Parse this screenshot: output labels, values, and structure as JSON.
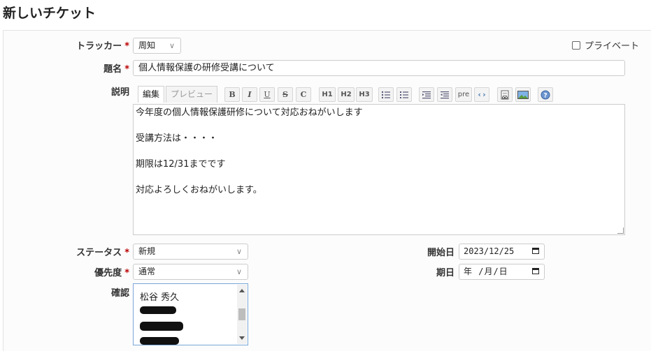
{
  "page": {
    "title": "新しいチケット"
  },
  "form": {
    "tracker": {
      "label": "トラッカー",
      "required_mark": "*",
      "value": "周知"
    },
    "private": {
      "label": "プライベート",
      "checked": false
    },
    "subject": {
      "label": "題名",
      "required_mark": "*",
      "value": "個人情報保護の研修受講について"
    },
    "description": {
      "label": "説明",
      "tabs": {
        "edit": "編集",
        "preview": "プレビュー"
      },
      "toolbar": {
        "bold": "B",
        "italic": "I",
        "underline": "U",
        "strike": "S",
        "code": "C",
        "h1": "H1",
        "h2": "H2",
        "h3": "H3",
        "pre": "pre"
      },
      "lines": [
        "今年度の個人情報保護研修について対応おねがいします",
        "",
        "受講方法は・・・・",
        "",
        "期限は12/31までです",
        "",
        "対応よろしくおねがいします。"
      ]
    },
    "status": {
      "label": "ステータス",
      "required_mark": "*",
      "value": "新規"
    },
    "priority": {
      "label": "優先度",
      "required_mark": "*",
      "value": "通常"
    },
    "start_date": {
      "label": "開始日",
      "value": "2023/12/25"
    },
    "due_date": {
      "label": "期日",
      "value": "年 /月/日"
    },
    "watchers": {
      "label": "確認",
      "options": [
        "松谷 秀久"
      ]
    }
  },
  "colors": {
    "required": "#bb0000",
    "focus_border": "#7aa7d8"
  }
}
